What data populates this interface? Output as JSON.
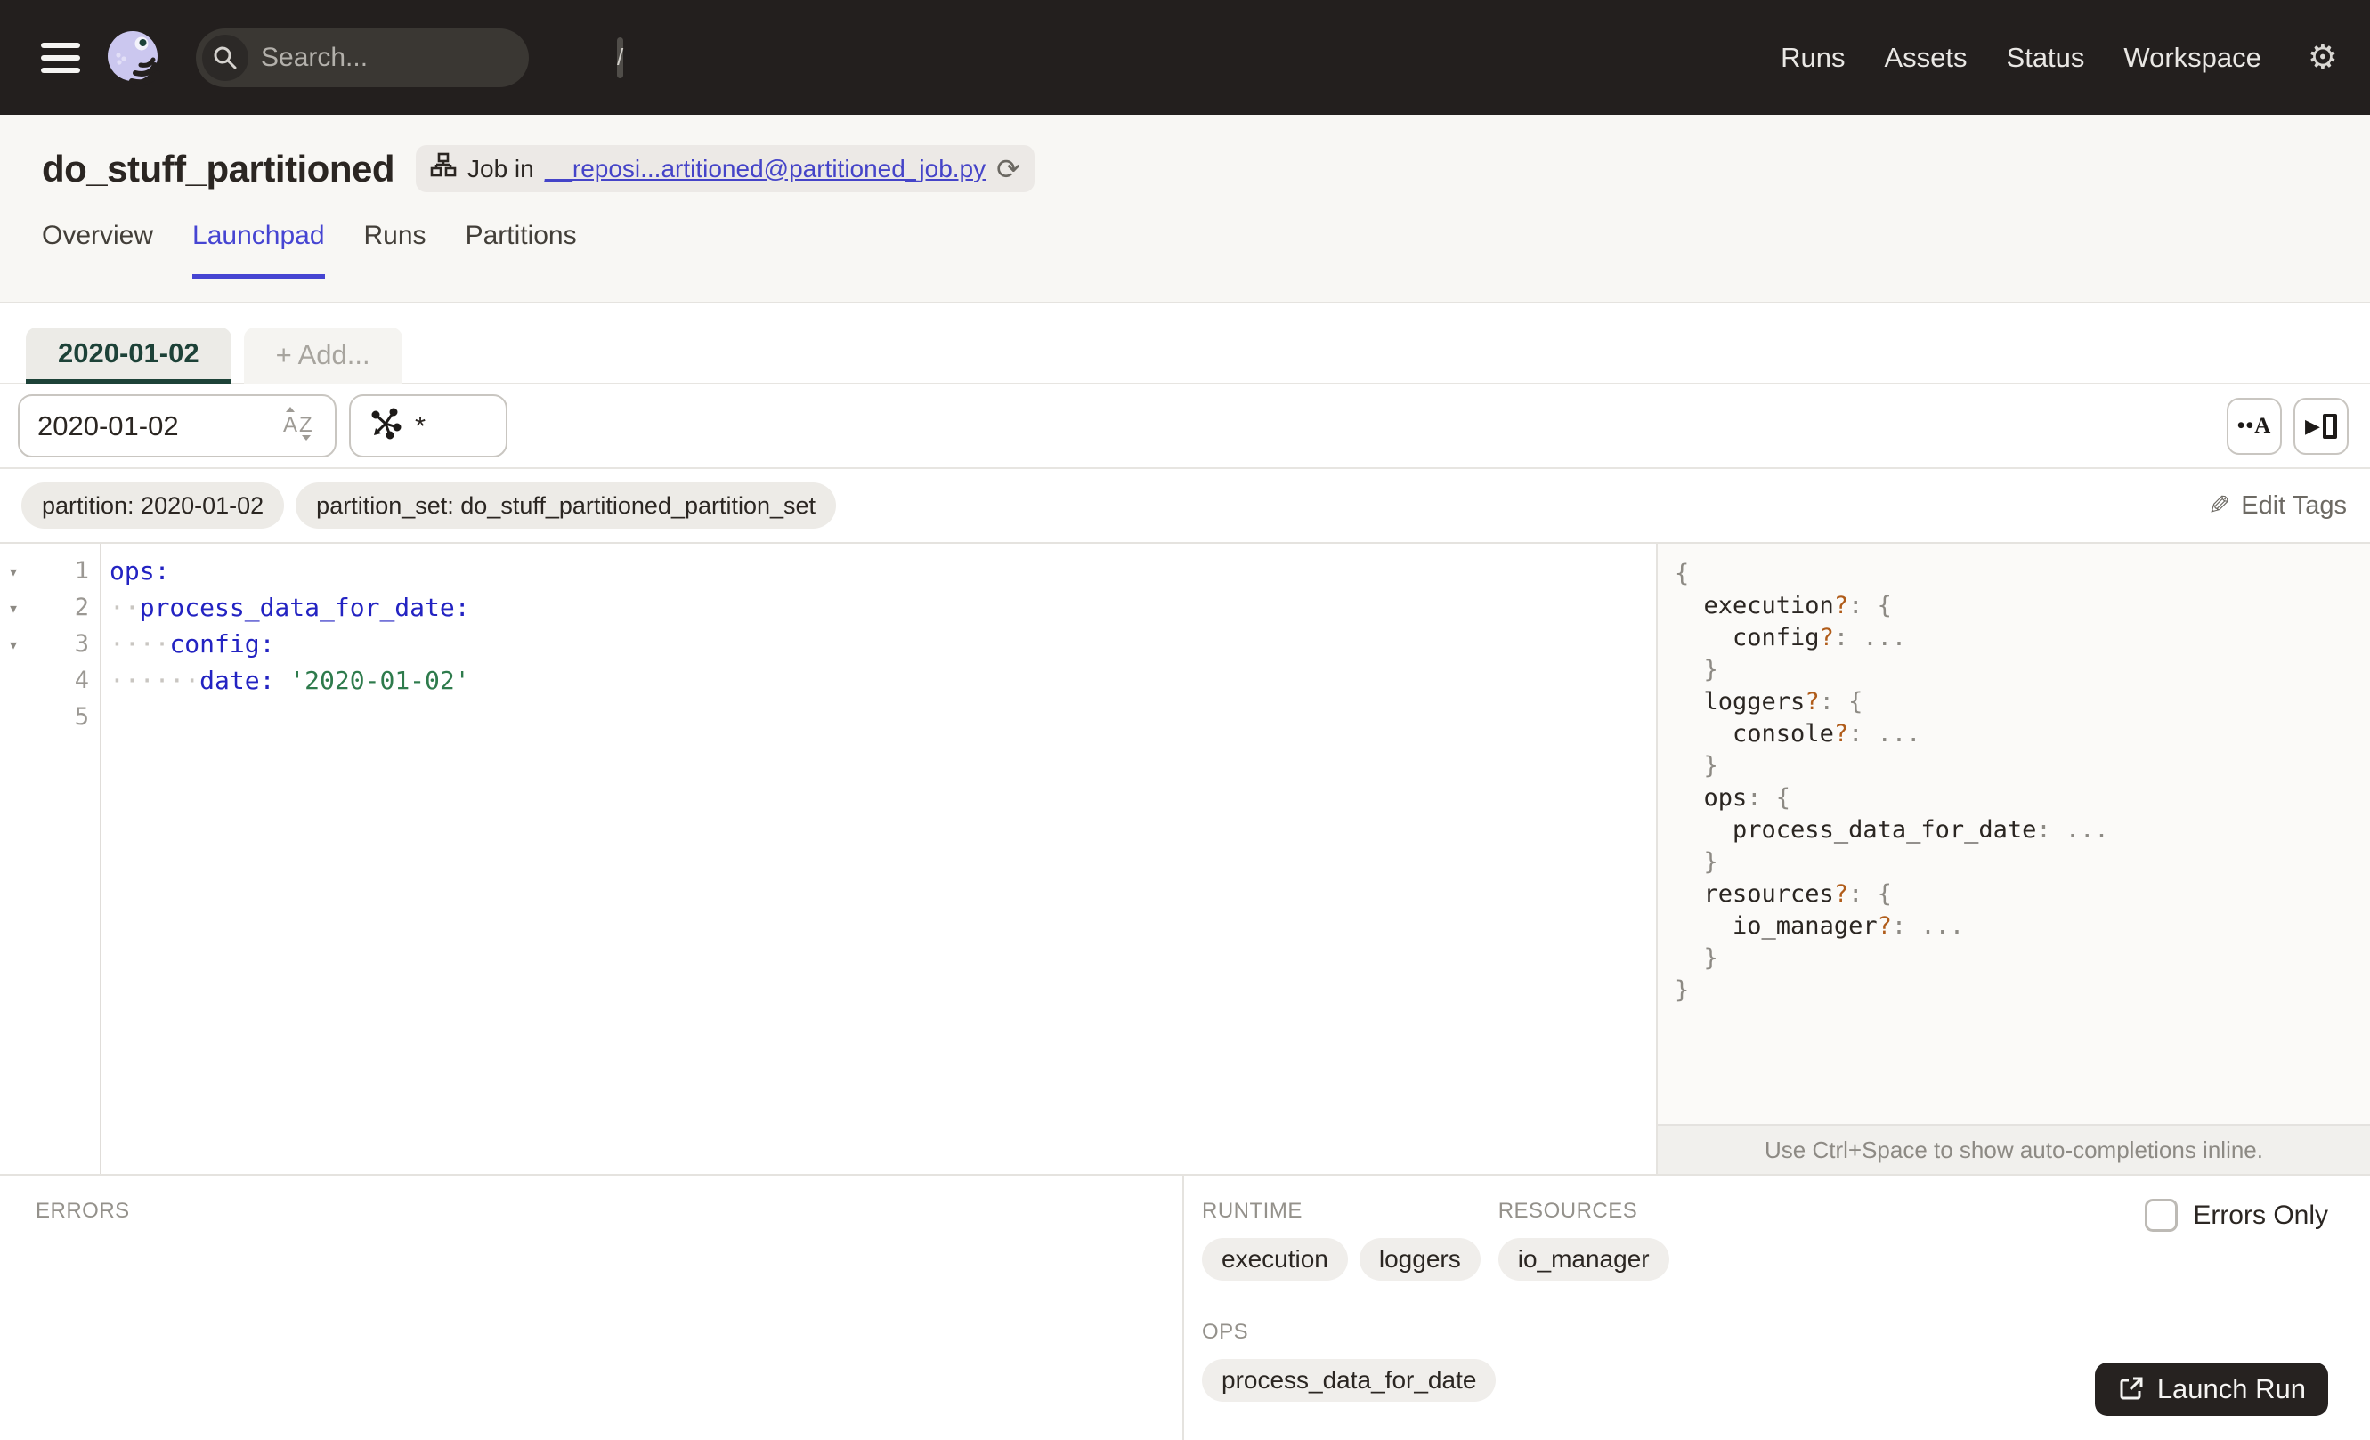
{
  "header": {
    "search_placeholder": "Search...",
    "search_shortcut": "/",
    "nav": [
      "Runs",
      "Assets",
      "Status",
      "Workspace"
    ]
  },
  "job": {
    "title": "do_stuff_partitioned",
    "badge_prefix": "Job in",
    "badge_link": "__reposi...artitioned@partitioned_job.py"
  },
  "tabs": [
    {
      "label": "Overview",
      "active": false
    },
    {
      "label": "Launchpad",
      "active": true
    },
    {
      "label": "Runs",
      "active": false
    },
    {
      "label": "Partitions",
      "active": false
    }
  ],
  "launchpad": {
    "config_tabs": [
      {
        "label": "2020-01-02",
        "active": true
      },
      {
        "label": "+ Add...",
        "active": false
      }
    ],
    "partition_input": "2020-01-02",
    "op_selector_value": "*",
    "tags": [
      "partition: 2020-01-02",
      "partition_set: do_stuff_partitioned_partition_set"
    ],
    "edit_tags_label": "Edit Tags"
  },
  "editor": {
    "lines": [
      {
        "num": "1",
        "fold": true,
        "segs": [
          [
            "key",
            "ops:"
          ]
        ]
      },
      {
        "num": "2",
        "fold": true,
        "segs": [
          [
            "ws",
            "··"
          ],
          [
            "key",
            "process_data_for_date:"
          ]
        ]
      },
      {
        "num": "3",
        "fold": true,
        "segs": [
          [
            "ws",
            "····"
          ],
          [
            "key",
            "config:"
          ]
        ]
      },
      {
        "num": "4",
        "fold": false,
        "segs": [
          [
            "ws",
            "······"
          ],
          [
            "key",
            "date:"
          ],
          [
            "pl",
            " "
          ],
          [
            "str",
            "'2020-01-02'"
          ]
        ]
      },
      {
        "num": "5",
        "fold": false,
        "segs": []
      }
    ]
  },
  "schema": {
    "lines": [
      [
        [
          "p",
          "{"
        ]
      ],
      [
        [
          "p",
          "  "
        ],
        [
          "k",
          "execution"
        ],
        [
          "q",
          "?"
        ],
        [
          "p",
          ": {"
        ]
      ],
      [
        [
          "p",
          "    "
        ],
        [
          "k",
          "config"
        ],
        [
          "q",
          "?"
        ],
        [
          "p",
          ": "
        ],
        [
          "e",
          "..."
        ]
      ],
      [
        [
          "p",
          "  }"
        ]
      ],
      [
        [
          "p",
          "  "
        ],
        [
          "k",
          "loggers"
        ],
        [
          "q",
          "?"
        ],
        [
          "p",
          ": {"
        ]
      ],
      [
        [
          "p",
          "    "
        ],
        [
          "k",
          "console"
        ],
        [
          "q",
          "?"
        ],
        [
          "p",
          ": "
        ],
        [
          "e",
          "..."
        ]
      ],
      [
        [
          "p",
          "  }"
        ]
      ],
      [
        [
          "p",
          "  "
        ],
        [
          "k",
          "ops"
        ],
        [
          "p",
          ": {"
        ]
      ],
      [
        [
          "p",
          "    "
        ],
        [
          "k",
          "process_data_for_date"
        ],
        [
          "p",
          ": "
        ],
        [
          "e",
          "..."
        ]
      ],
      [
        [
          "p",
          "  }"
        ]
      ],
      [
        [
          "p",
          "  "
        ],
        [
          "k",
          "resources"
        ],
        [
          "q",
          "?"
        ],
        [
          "p",
          ": {"
        ]
      ],
      [
        [
          "p",
          "    "
        ],
        [
          "k",
          "io_manager"
        ],
        [
          "q",
          "?"
        ],
        [
          "p",
          ": "
        ],
        [
          "e",
          "..."
        ]
      ],
      [
        [
          "p",
          "  }"
        ]
      ],
      [
        [
          "p",
          "}"
        ]
      ]
    ],
    "hint": "Use Ctrl+Space to show auto-completions inline."
  },
  "bottom": {
    "errors_label": "ERRORS",
    "errors_only_label": "Errors Only",
    "groups": [
      {
        "label": "RUNTIME",
        "tags": [
          "execution",
          "loggers"
        ]
      },
      {
        "label": "RESOURCES",
        "tags": [
          "io_manager"
        ]
      },
      {
        "label": "OPS",
        "tags": [
          "process_data_for_date"
        ]
      }
    ],
    "launch_label": "Launch Run"
  },
  "colors": {
    "header_bg": "#231f1e",
    "accent_tab": "#4645d2",
    "partition_green": "#1d4238",
    "code_key": "#2323c2",
    "code_string": "#2e7b4c",
    "schema_optional": "#b05c1a"
  }
}
